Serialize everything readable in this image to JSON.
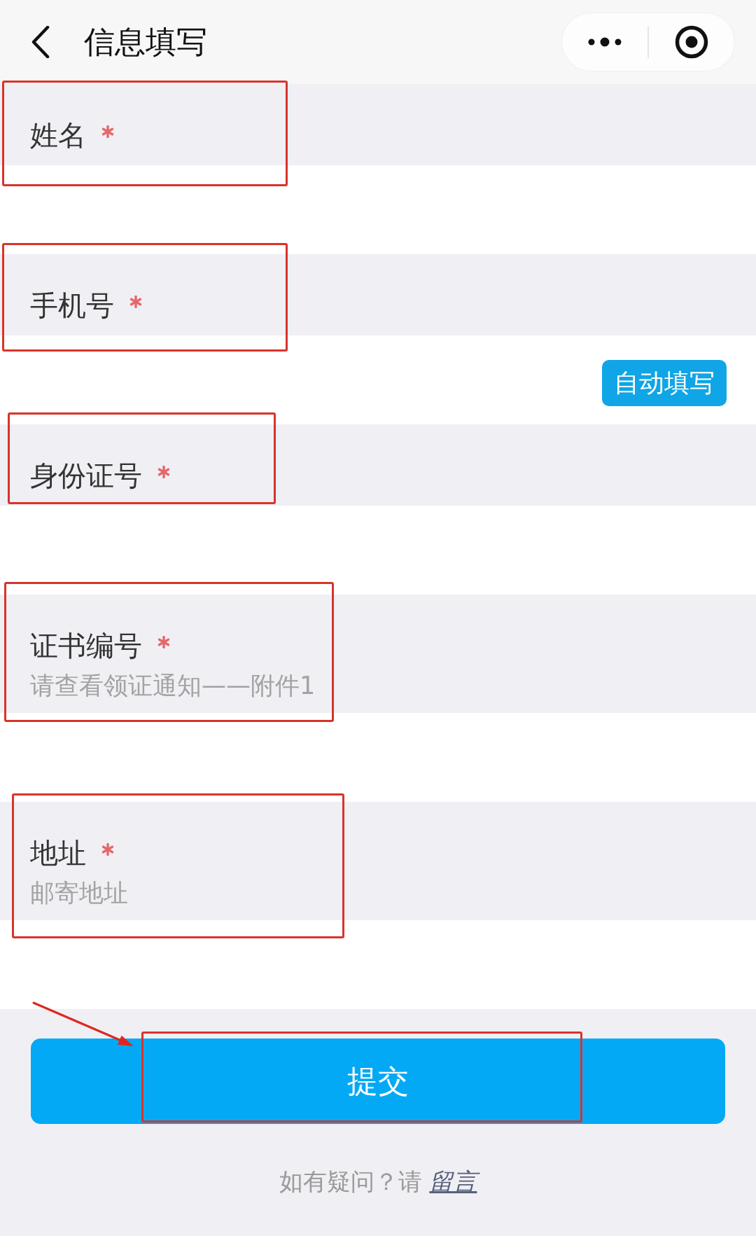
{
  "nav": {
    "title": "信息填写"
  },
  "fields": [
    {
      "label": "姓名",
      "required": true,
      "highlighted": true
    },
    {
      "label": "手机号",
      "required": true,
      "highlighted": true,
      "autofill_button": "自动填写"
    },
    {
      "label": "身份证号",
      "required": true,
      "highlighted": true
    },
    {
      "label": "证书编号",
      "required": true,
      "highlighted": true,
      "description": "请查看领证通知——附件1"
    },
    {
      "label": "地址",
      "required": true,
      "highlighted": true,
      "description": "邮寄地址"
    }
  ],
  "submit": {
    "label": "提交",
    "highlighted": true,
    "arrow": true
  },
  "help": {
    "text": "如有疑问？请",
    "link": "留言"
  }
}
